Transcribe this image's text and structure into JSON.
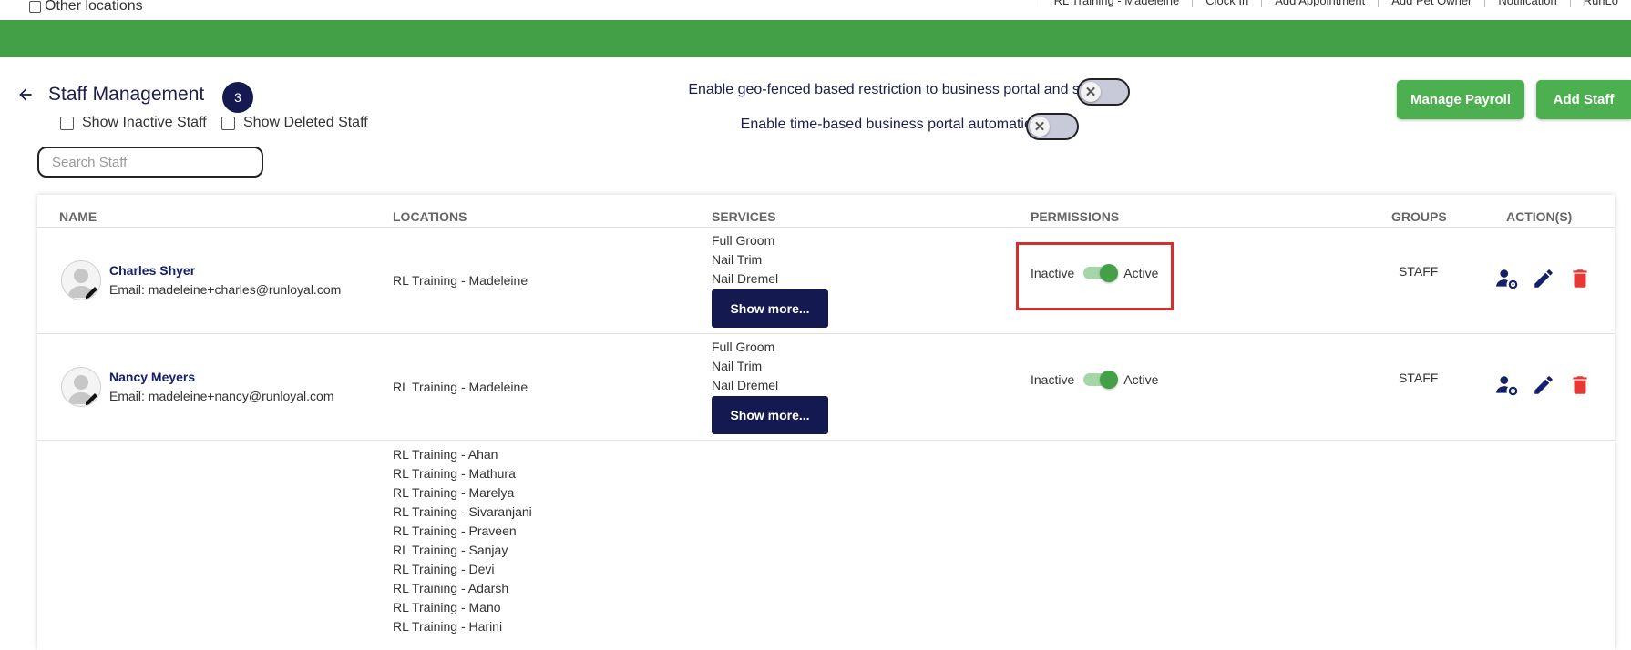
{
  "topbar": {
    "other_locations": "Other locations",
    "nav": [
      "RL Training - Madeleine",
      "Clock In",
      "Add Appointment",
      "Add Pet Owner",
      "Notification",
      "RunLo"
    ]
  },
  "header": {
    "title": "Staff Management",
    "count": "3",
    "show_inactive": "Show Inactive Staff",
    "show_deleted": "Show Deleted Staff",
    "geo_label": "Enable geo-fenced based restriction to business portal and staff app",
    "time_label": "Enable time-based business portal automatic logout",
    "manage_payroll": "Manage Payroll",
    "add_staff": "Add Staff"
  },
  "search": {
    "placeholder": "Search Staff"
  },
  "table": {
    "headers": [
      "NAME",
      "LOCATIONS",
      "SERVICES",
      "PERMISSIONS",
      "GROUPS",
      "ACTION(S)"
    ],
    "rows": [
      {
        "name": "Charles Shyer",
        "email": "Email: madeleine+charles@runloyal.com",
        "location": "RL Training - Madeleine",
        "services": [
          "Full Groom",
          "Nail Trim",
          "Nail Dremel"
        ],
        "show_more": "Show more...",
        "perm_inactive": "Inactive",
        "perm_active": "Active",
        "group": "STAFF"
      },
      {
        "name": "Nancy Meyers",
        "email": "Email: madeleine+nancy@runloyal.com",
        "location": "RL Training - Madeleine",
        "services": [
          "Full Groom",
          "Nail Trim",
          "Nail Dremel"
        ],
        "show_more": "Show more...",
        "perm_inactive": "Inactive",
        "perm_active": "Active",
        "group": "STAFF"
      }
    ],
    "third_row_locations": [
      "RL Training - Ahan",
      "RL Training - Mathura",
      "RL Training - Marelya",
      "RL Training - Sivaranjani",
      "RL Training - Praveen",
      "RL Training - Sanjay",
      "RL Training - Devi",
      "RL Training - Adarsh",
      "RL Training - Mano",
      "RL Training - Harini"
    ]
  },
  "colors": {
    "green_bar": "#43a047",
    "navy": "#141a4f",
    "delete_red": "#e53935",
    "highlight": "#d32f2f"
  },
  "icons": [
    "back-arrow-icon",
    "close-x-icon",
    "user-settings-icon",
    "edit-pencil-icon",
    "trash-icon",
    "avatar-placeholder-icon"
  ]
}
